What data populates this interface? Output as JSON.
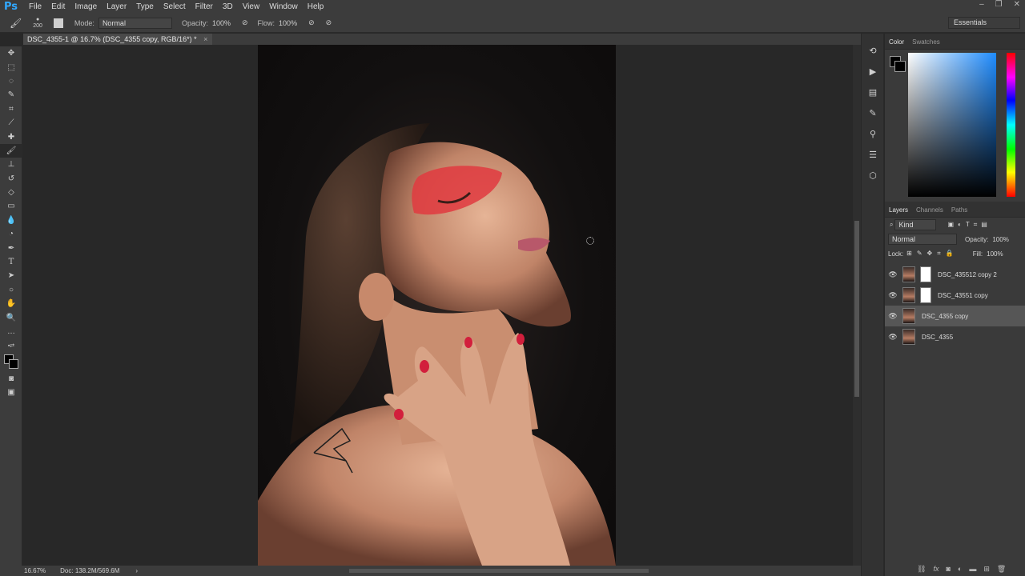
{
  "app": {
    "logo": "Ps"
  },
  "menu": [
    "File",
    "Edit",
    "Image",
    "Layer",
    "Type",
    "Select",
    "Filter",
    "3D",
    "View",
    "Window",
    "Help"
  ],
  "window_controls": [
    "–",
    "❐",
    "✕"
  ],
  "options": {
    "brush_size": "200",
    "mode_label": "Mode:",
    "mode_value": "Normal",
    "opacity_label": "Opacity:",
    "opacity_value": "100%",
    "flow_label": "Flow:",
    "flow_value": "100%",
    "workspace": "Essentials"
  },
  "document_tab": "DSC_4355-1 @ 16.7% (DSC_4355 copy, RGB/16*) *",
  "status": {
    "zoom": "16.67%",
    "doc": "Doc: 138.2M/569.6M"
  },
  "color_panel": {
    "tabs": [
      "Color",
      "Swatches"
    ],
    "foreground": "#000000",
    "background": "#ffffff"
  },
  "layers_panel": {
    "tabs": [
      "Layers",
      "Channels",
      "Paths"
    ],
    "kind_label": "Kind",
    "blend_mode": "Normal",
    "opacity_label": "Opacity:",
    "opacity_value": "100%",
    "lock_label": "Lock:",
    "fill_label": "Fill:",
    "fill_value": "100%",
    "layers": [
      {
        "name": "DSC_435512 copy 2",
        "has_mask": true,
        "selected": false
      },
      {
        "name": "DSC_43551 copy",
        "has_mask": true,
        "selected": false
      },
      {
        "name": "DSC_4355 copy",
        "has_mask": false,
        "selected": true
      },
      {
        "name": "DSC_4355",
        "has_mask": false,
        "selected": false
      }
    ]
  },
  "colors": {
    "accent": "#31a8ff",
    "panel": "#3a3a3a",
    "canvas": "#282828"
  }
}
